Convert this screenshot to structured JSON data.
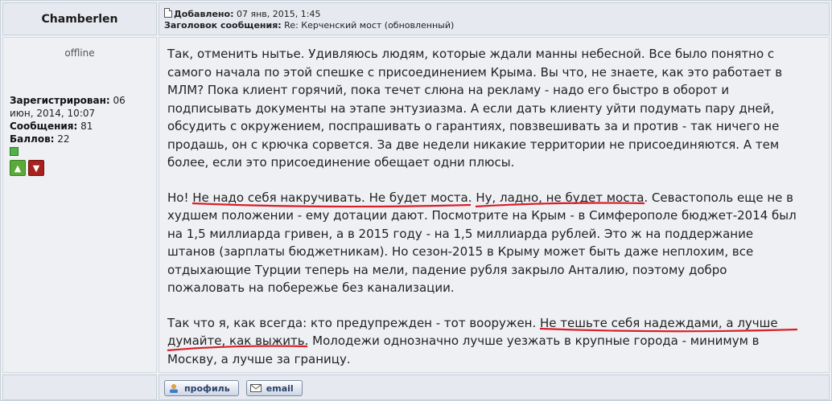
{
  "author": {
    "name": "Chamberlen",
    "status": "offline",
    "registered_label": "Зарегистрирован:",
    "registered_value": " 06 июн, 2014, 10:07",
    "posts_label": "Сообщения:",
    "posts_value": " 81",
    "points_label": "Баллов:",
    "points_value": " 22"
  },
  "post": {
    "added_label": "Добавлено:",
    "added_value": " 07 янв, 2015, 1:45",
    "subject_label": "Заголовок сообщения:",
    "subject_value": " Re: Керченский мост (обновленный)",
    "p1": "Так, отменить нытье. Удивляюсь людям, которые ждали манны небесной. Все было понятно с самого начала по этой спешке с присоединением Крыма. Вы что, не знаете, как это работает в МЛМ? Пока клиент горячий, пока течет слюна на рекламу - надо его быстро в оборот и подписывать документы на этапе энтузиазма. А если дать клиенту уйти подумать пару дней, обсудить с окружением, поспрашивать о гарантиях, повзвешивать за и против - так ничего не продашь, он с крючка сорвется. За две недели никакие территории не присоединяются. А тем более, если это присоединение обещает одни плюсы.",
    "p2_a": "Но! ",
    "p2_u1": "Не надо себя накручивать. Не будет моста",
    "p2_b": ". ",
    "p2_u2": "Ну, ладно, не будет моста",
    "p2_c": ". Севастополь еще не в худшем положении - ему дотации дают. Посмотрите на Крым - в Симферополе бюджет-2014 был на 1,5 миллиарда гривен, а в 2015 году - на 1,5 миллиарда рублей. Это ж на поддержание штанов (зарплаты бюджетникам). Но сезон-2015 в Крыму может быть даже неплохим, все отдыхающие Турции теперь на мели, падение рубля закрыло Анталию, поэтому добро пожаловать на побережье без канализации.",
    "p3_a": "Так что я, как всегда: кто предупрежден - тот вооружен. ",
    "p3_u1": "Не тешьте себя надеждами, а лучше",
    "p3_u2": "думайте, как выжить.",
    "p3_b": " Молодежи однозначно лучше уезжать в крупные города - минимум в Москву, а лучше за границу."
  },
  "footer": {
    "profile_label": "профиль",
    "email_label": "email"
  },
  "colors": {
    "underline": "#d9202a"
  }
}
